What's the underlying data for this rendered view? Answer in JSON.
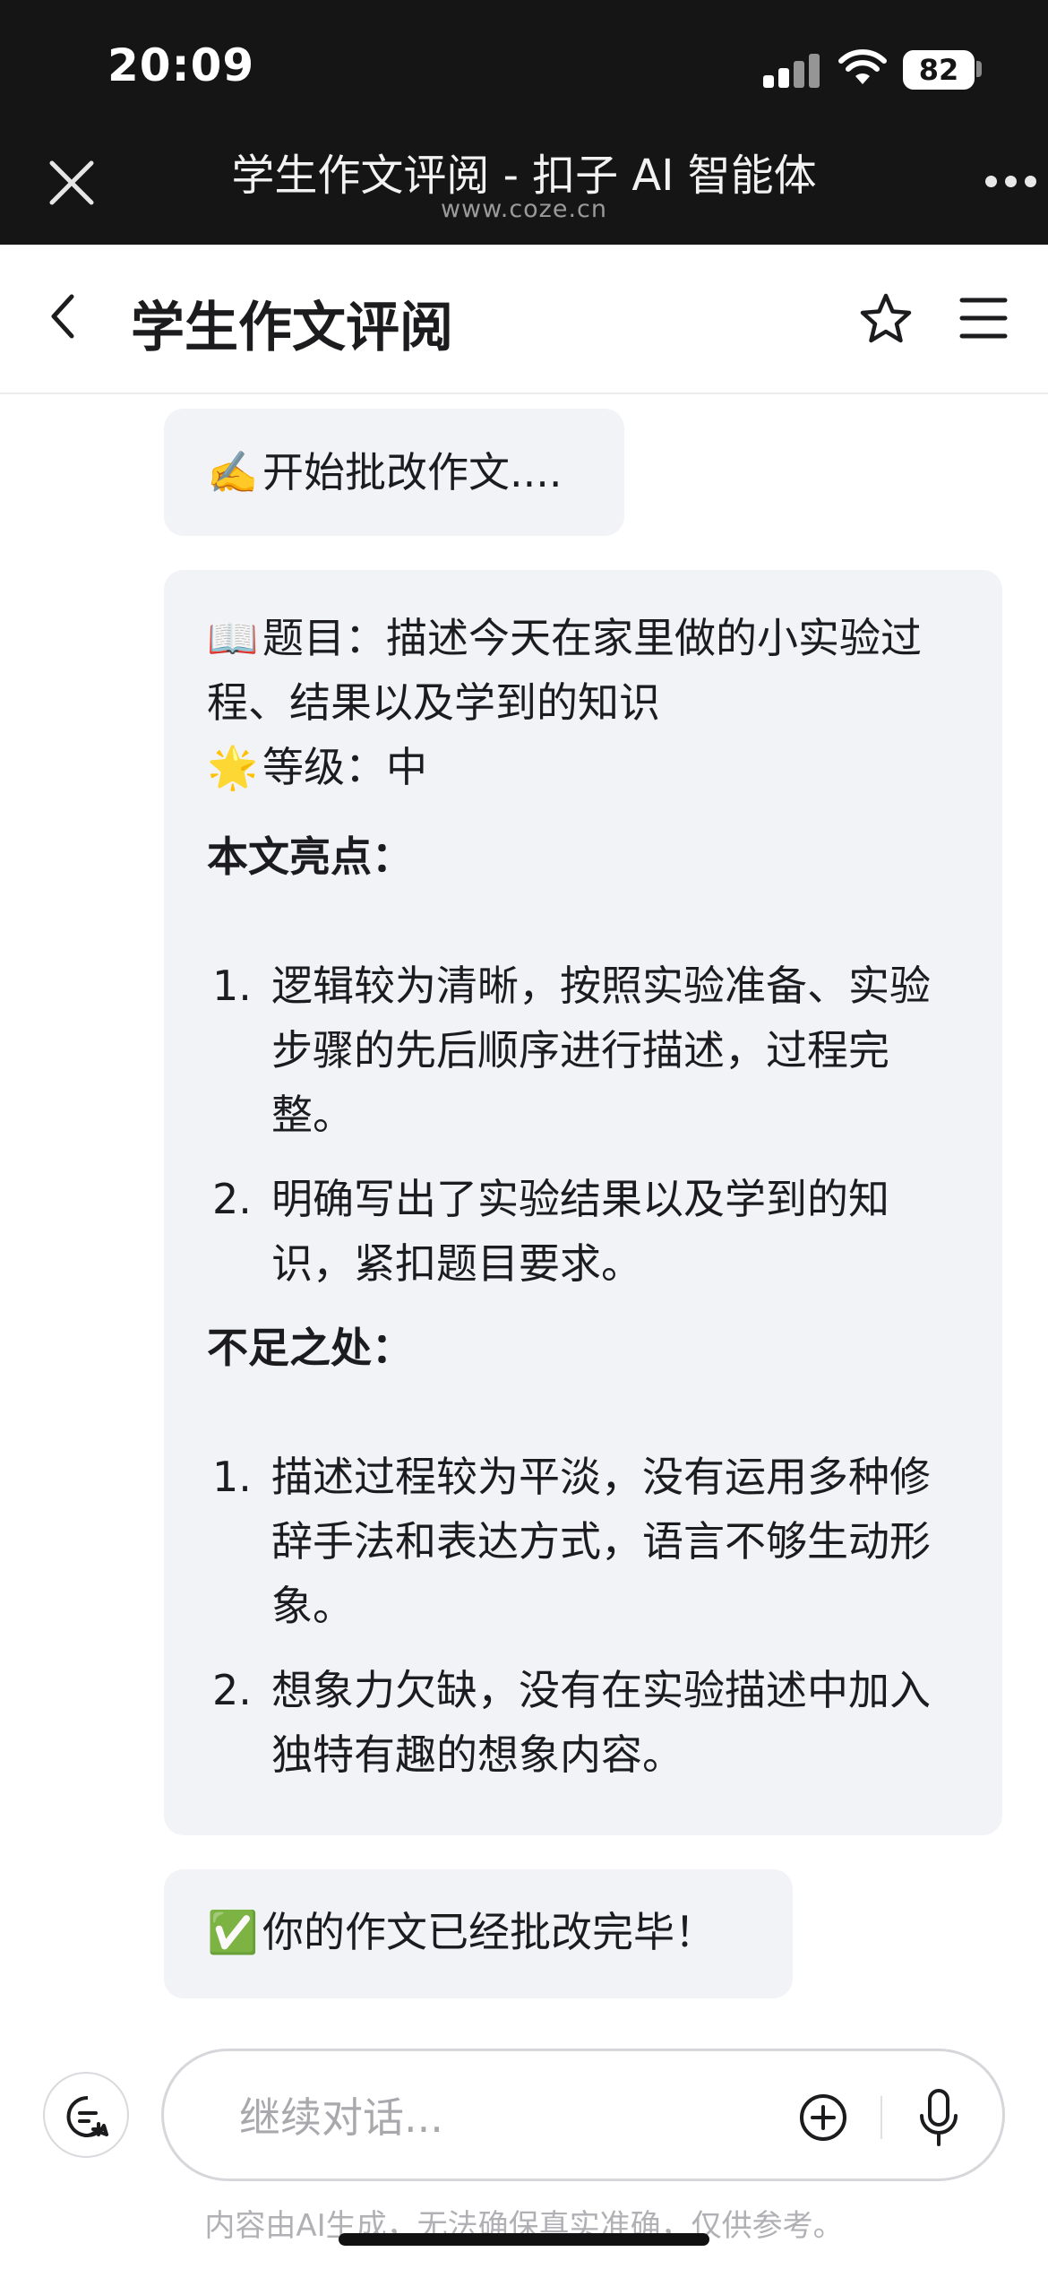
{
  "status_bar": {
    "time": "20:09",
    "battery": "82"
  },
  "browser": {
    "title": "学生作文评阅 - 扣子 AI 智能体",
    "url": "www.coze.cn"
  },
  "header": {
    "title": "学生作文评阅"
  },
  "messages": {
    "start": {
      "emoji": "✍️",
      "text": "开始批改作文...."
    },
    "review": {
      "topic_emoji": "📖",
      "topic": "题目：描述今天在家里做的小实验过程、结果以及学到的知识",
      "grade_emoji": "🌟",
      "grade": "等级：中",
      "highlights_title": "本文亮点：",
      "highlights": [
        "逻辑较为清晰，按照实验准备、实验步骤的先后顺序进行描述，过程完整。",
        "明确写出了实验结果以及学到的知识，紧扣题目要求。"
      ],
      "weaknesses_title": "不足之处：",
      "weaknesses": [
        "描述过程较为平淡，没有运用多种修辞手法和表达方式，语言不够生动形象。",
        "想象力欠缺，没有在实验描述中加入独特有趣的想象内容。"
      ]
    },
    "done": {
      "emoji": "✅",
      "text": "你的作文已经批改完毕！"
    }
  },
  "list_numbers": [
    "1.",
    "2."
  ],
  "composer": {
    "placeholder": "继续对话...",
    "disclaimer": "内容由AI生成，无法确保真实准确，仅供参考。"
  }
}
